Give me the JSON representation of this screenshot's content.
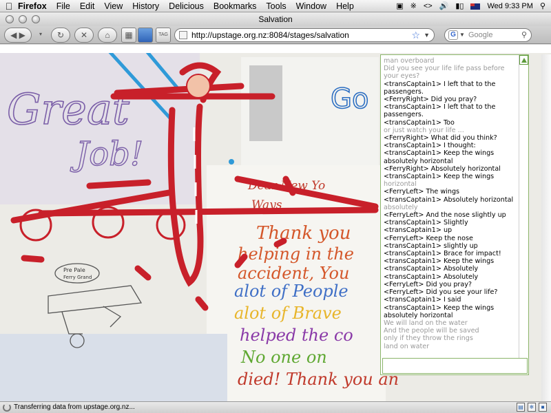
{
  "menubar": {
    "app": "Firefox",
    "items": [
      "File",
      "Edit",
      "View",
      "History",
      "Delicious",
      "Bookmarks",
      "Tools",
      "Window",
      "Help"
    ],
    "clock": "Wed 9:33 PM"
  },
  "window": {
    "title": "Salvation"
  },
  "toolbar": {
    "url": "http://upstage.org.nz:8084/stages/salvation",
    "search_placeholder": "Google"
  },
  "chat": {
    "lines": [
      {
        "text": "man overboard",
        "dim": true
      },
      {
        "text": "Did you see your life life pass before your eyes?",
        "dim": true
      },
      {
        "text": "<transCaptain1> I left that to the passengers.",
        "dim": false
      },
      {
        "text": "<FerryRight> Did you pray?",
        "dim": false
      },
      {
        "text": "<transCaptain1> I left that to the passengers.",
        "dim": false
      },
      {
        "text": "<transCaptain1> Too",
        "dim": false
      },
      {
        "text": "or just watch your life ...",
        "dim": true
      },
      {
        "text": "<FerryRight> What did you think?",
        "dim": false
      },
      {
        "text": "<transCaptain1> I thought:",
        "dim": false
      },
      {
        "text": "<transCaptain1> Keep the wings absolutely horizontal",
        "dim": false
      },
      {
        "text": "<FerryRight> Absolutely horizontal",
        "dim": false
      },
      {
        "text": "<transCaptain1> Keep the wings",
        "dim": false
      },
      {
        "text": "horizontal",
        "dim": true
      },
      {
        "text": "<FerryLeft> The wings",
        "dim": false
      },
      {
        "text": "<transCaptain1> Absolutely horizontal",
        "dim": false
      },
      {
        "text": "absolutely",
        "dim": true
      },
      {
        "text": "<FerryLeft> And the nose slightly up",
        "dim": false
      },
      {
        "text": "<transCaptain1> Slightly",
        "dim": false
      },
      {
        "text": "<transCaptain1> up",
        "dim": false
      },
      {
        "text": "<FerryLeft> Keep the nose",
        "dim": false
      },
      {
        "text": "<transCaptain1> slightly up",
        "dim": false
      },
      {
        "text": "<transCaptain1> Brace for impact!",
        "dim": false
      },
      {
        "text": "<transCaptain1> Keep the wings",
        "dim": false
      },
      {
        "text": "<transCaptain1> Absolutely",
        "dim": false
      },
      {
        "text": "<transCaptain1> Absolutely",
        "dim": false
      },
      {
        "text": "<FerryLeft> Did you pray?",
        "dim": false
      },
      {
        "text": "<FerryLeft> Did you see your life?",
        "dim": false
      },
      {
        "text": "<transCaptain1> I said",
        "dim": false
      },
      {
        "text": "<transCaptain1> Keep the wings absolutely horizontal",
        "dim": false
      },
      {
        "text": "We will land on the water",
        "dim": true
      },
      {
        "text": "And the people will be saved",
        "dim": true
      },
      {
        "text": "only if they throw the rings",
        "dim": true
      },
      {
        "text": "land on water",
        "dim": true
      }
    ]
  },
  "drawing": {
    "texts": {
      "great": "Great",
      "job": "Job!",
      "go": "Go",
      "dear": "Dear New Yo",
      "ways": "Ways",
      "thank_you": "Thank you",
      "helping": "helping in the",
      "accident": "accident, You",
      "alot_people": "alot of People",
      "alot_brave": "alot of Brave",
      "helped": "helped the co",
      "no_one": "No one on",
      "died": "died! Thank you an",
      "sign": "Pre Pale",
      "sign2": "Ferry Grand"
    }
  },
  "status": {
    "text": "Transferring data from upstage.org.nz..."
  }
}
